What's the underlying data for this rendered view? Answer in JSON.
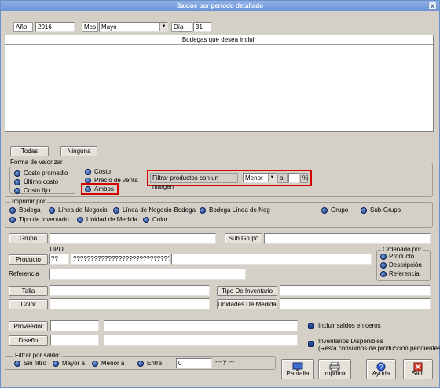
{
  "window": {
    "title": "Saldos por período detallado",
    "close": "x"
  },
  "date": {
    "year_label": "Año",
    "year_value": "2016",
    "month_label": "Mes",
    "month_value": "Mayo",
    "day_label": "Día",
    "day_value": "31"
  },
  "bodegas": {
    "header": "Bodegas que desea incluir"
  },
  "buttons": {
    "todas": "Todas",
    "ninguna": "Ninguna"
  },
  "valorizar": {
    "title": "Forma de valorizar",
    "left_options": [
      "Costo promedio",
      "Último costo",
      "Costo fijo"
    ],
    "right_options": [
      "Costo",
      "Precio de venta",
      "Ambos"
    ],
    "filter_label": "Filtrar productos con un margen",
    "filter_op": "Menor",
    "filter_al": "al",
    "filter_value": "",
    "filter_pct": "%"
  },
  "imprimir_por": {
    "title": "Imprimir por",
    "row1": [
      "Bodega",
      "Línea de Negocio",
      "Línea de Negocio-Bodega",
      "Bodega Línea de Neg",
      "Grupo",
      "Sub-Grupo"
    ],
    "row2": [
      "Tipo de Inventario",
      "Unidad de Medida",
      "Color"
    ]
  },
  "filters": {
    "grupo": "Grupo",
    "sub_grupo": "Sub Grupo",
    "tipo_label": "TIPO",
    "producto": "Producto",
    "producto_code": "??",
    "producto_desc": "????????????????????????????",
    "referencia": "Referencia",
    "talla": "Talla",
    "tipo_inventario": "Tipo De Inventario",
    "color": "Color",
    "unidades_medida": "Unidades De Medida",
    "proveedor": "Proveedor",
    "diseno": "Diseño"
  },
  "ordenado": {
    "title": "Ordenado por",
    "options": [
      "Producto",
      "Descripción",
      "Referencia"
    ]
  },
  "checks": {
    "incluir_saldos": "Incluir saldos en ceros",
    "inventarios_line1": "Inventarios Disponibles",
    "inventarios_line2": "(Resta consumos de producción pendientes)"
  },
  "filtrar_saldo": {
    "title": "Filtrar por saldo:",
    "options": [
      "Sin filtro",
      "Mayor a",
      "Menor a",
      "Entre"
    ],
    "value": "0",
    "separator": "--- y ---"
  },
  "actions": {
    "pantalla": "Pantalla",
    "imprimir": "Imprimir",
    "ayuda": "Ayuda",
    "salir": "Salir"
  }
}
